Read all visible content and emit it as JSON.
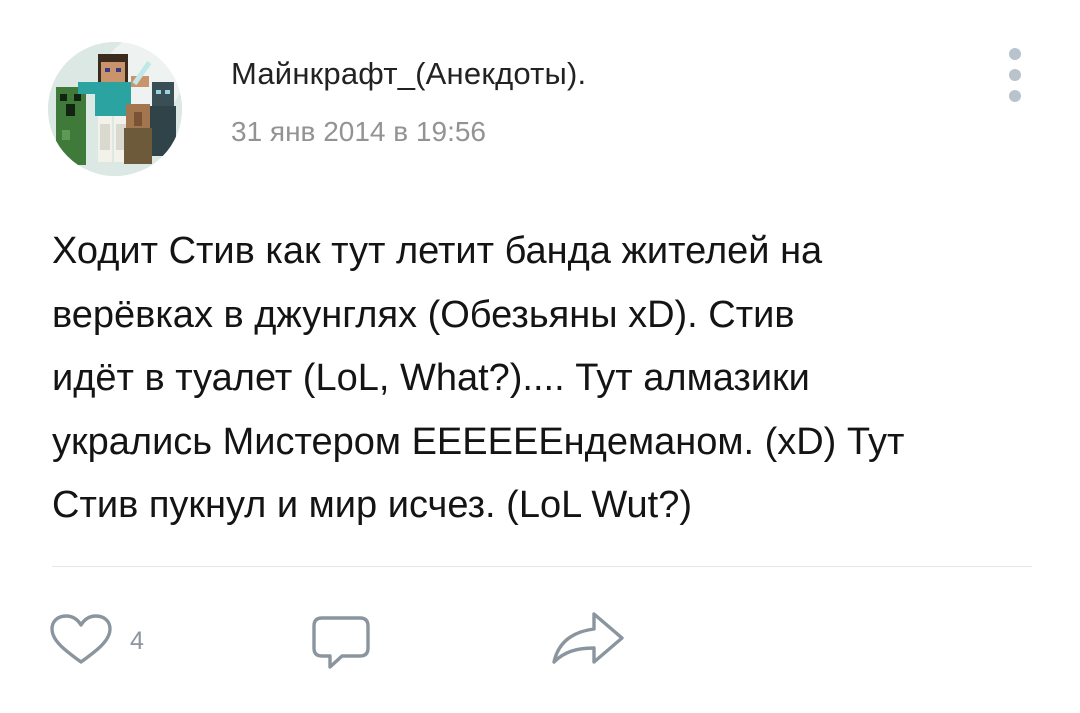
{
  "post": {
    "author": "Майнкрафт_(Анекдоты).",
    "timestamp": "31 янв 2014 в 19:56",
    "text_lines": [
      "Ходит Стив как тут летит банда жителей на",
      "верёвках в джунглях (Обезьяны xD). Стив",
      "идёт в туалет (LoL, What?).... Тут алмазики",
      "укрались Мистером ЕЕЕЕЕЕндеманом. (xD) Тут",
      "Стив пукнул и мир исчез. (LoL Wut?)"
    ]
  },
  "actions": {
    "likes_count": "4",
    "like_icon": "heart-icon",
    "comment_icon": "comment-icon",
    "share_icon": "share-icon",
    "menu_icon": "more-vertical-icon"
  },
  "colors": {
    "icon_gray": "#8a959f",
    "timestamp_gray": "#939393",
    "menu_dots": "#b9c3cc"
  }
}
